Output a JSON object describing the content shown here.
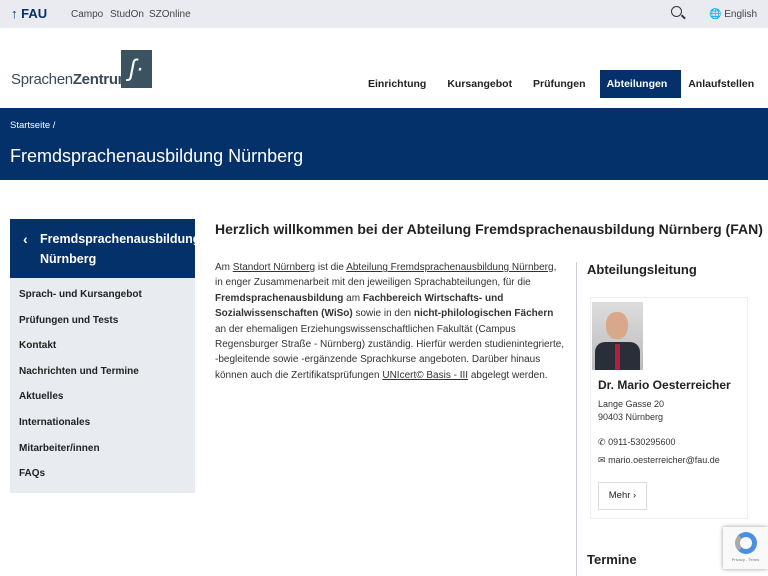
{
  "topbar": {
    "brand": "↑ FAU",
    "links": [
      "Campo",
      "StudOn",
      "SZOnline"
    ],
    "language": "English"
  },
  "logo": {
    "text_light": "Sprachen",
    "text_bold": "Zentrum",
    "mark": "ʃ·"
  },
  "nav": {
    "items": [
      "Einrichtung ▾",
      "Kursangebot ▾",
      "Prüfungen ▾",
      "Abteilungen ▾",
      "Anlaufstellen ▾"
    ],
    "active": "Abteilungen"
  },
  "breadcrumb": {
    "home": "Startseite  /"
  },
  "page_title": "Fremdsprachenausbildung Nürnberg",
  "sidebar": {
    "back_icon": "‹",
    "title": "Fremdsprachenausbildung Nürnberg",
    "items": [
      "Sprach- und Kursangebot",
      "Prüfungen und Tests",
      "Kontakt",
      "Nachrichten und Termine",
      "Aktuelles",
      "Internationales",
      "Mitarbeiter/innen",
      "FAQs"
    ]
  },
  "main": {
    "heading": "Herzlich willkommen bei der Abteilung Fremdsprachenausbildung Nürnberg (FAN)",
    "p": [
      "Am ",
      "Standort Nürnberg",
      " ist die ",
      "Abteilung Fremdsprachenausbildung Nürnberg",
      ", in enger Zusammenarbeit mit den jeweiligen Sprachabteilungen, für die ",
      "Fremdsprachenausbildung",
      " am ",
      "Fachbereich Wirtschafts- und Sozialwissenschaften (WiSo)",
      " sowie in den ",
      "nicht-philologischen Fächern",
      " an der ehemaligen Erziehungswissenschaftlichen Fakultät (Campus Regensburger Straße - Nürnberg) zuständig. Hierfür werden studienintegrierte, -begleitende sowie -ergänzende Sprachkurse angeboten. Darüber hinaus können auch die Zertifikatsprüfungen ",
      "UNIcert© Basis - III",
      " abgelegt werden."
    ]
  },
  "right": {
    "heading": "Abteilungsleitung",
    "contact": {
      "name": "Dr. Mario Oesterreicher",
      "street": "Lange Gasse 20",
      "city": "90403 Nürnberg",
      "phone": "0911-530295600",
      "email": "mario.oesterreicher@fau.de",
      "more": "Mehr ›"
    },
    "termine": "Termine"
  },
  "recaptcha": {
    "text": "Privacy - Terms"
  }
}
